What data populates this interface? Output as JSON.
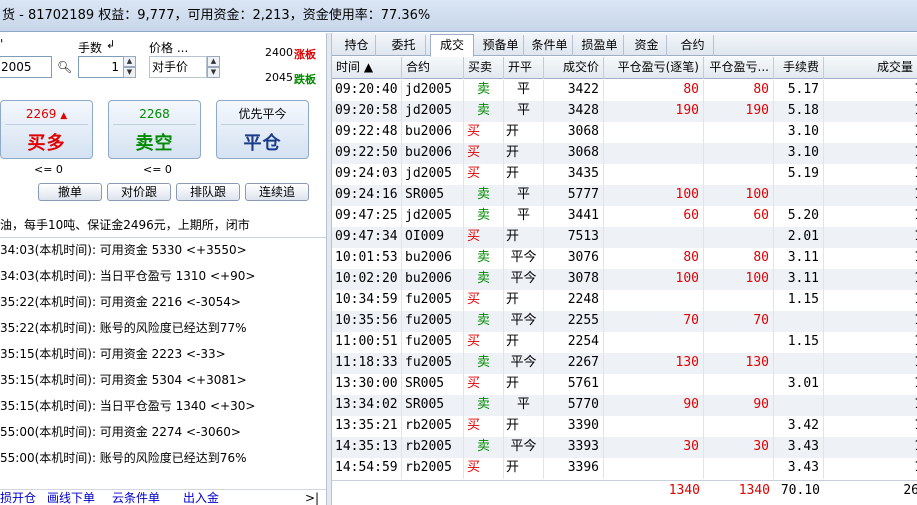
{
  "header": {
    "title": "货 - 81702189  权益：9,777，可用资金：2,213，资金使用率：77.36%"
  },
  "order": {
    "code_label": "'",
    "code_value": "2005",
    "qty_label": "手数",
    "qty_value": "1",
    "price_label": "价格 ...",
    "price_value": "对手价",
    "limit_up_price": "2400",
    "limit_up_label": "涨板",
    "limit_down_price": "2045",
    "limit_down_label": "跌板",
    "buy_price": "2269",
    "buy_label": "买多",
    "sell_price": "2268",
    "sell_label": "卖空",
    "close_top": "优先平今",
    "close_label": "平仓",
    "buy_avail": "<= 0",
    "sell_avail": "<= 0",
    "btn_cancel": "撤单",
    "btn_chase": "对价跟",
    "btn_queue": "排队跟",
    "btn_continuous": "连续追"
  },
  "info_line": "油，每手10吨、保证金2496元，上期所，闭市",
  "log": [
    "34:03(本机时间): 可用资金 5330 <+3550>",
    "34:03(本机时间): 当日平仓盈亏 1310 <+90>",
    "35:22(本机时间): 可用资金 2216 <-3054>",
    "35:22(本机时间): 账号的风险度已经达到77%",
    "35:15(本机时间): 可用资金 2223 <-33>",
    "35:15(本机时间): 可用资金 5304 <+3081>",
    "35:15(本机时间): 当日平仓盈亏 1340 <+30>",
    "55:00(本机时间): 可用资金 2274 <-3060>",
    "55:00(本机时间): 账号的风险度已经达到76%"
  ],
  "bottom_links": [
    "损开仓",
    "画线下单",
    "云条件单",
    "出入金",
    ">|"
  ],
  "tabs": [
    "持仓",
    "委托",
    "成交",
    "预备单",
    "条件单",
    "损盈单",
    "资金",
    "合约"
  ],
  "active_tab": 2,
  "columns": [
    "时间 ▲",
    "合约",
    "买卖",
    "开平",
    "成交价",
    "平仓盈亏(逐笔)",
    "平仓盈亏...",
    "手续费",
    "成交量"
  ],
  "rows": [
    [
      "09:20:40",
      "jd2005",
      "卖",
      "平",
      "3422",
      "80",
      "80",
      "5.17",
      "1"
    ],
    [
      "09:20:58",
      "jd2005",
      "卖",
      "平",
      "3428",
      "190",
      "190",
      "5.18",
      "1"
    ],
    [
      "09:22:48",
      "bu2006",
      "买",
      "开",
      "3068",
      "",
      "",
      "3.10",
      "1"
    ],
    [
      "09:22:50",
      "bu2006",
      "买",
      "开",
      "3068",
      "",
      "",
      "3.10",
      "1"
    ],
    [
      "09:24:03",
      "jd2005",
      "买",
      "开",
      "3435",
      "",
      "",
      "5.19",
      "1"
    ],
    [
      "09:24:16",
      "SR005",
      "卖",
      "平",
      "5777",
      "100",
      "100",
      "",
      "1"
    ],
    [
      "09:47:25",
      "jd2005",
      "卖",
      "平",
      "3441",
      "60",
      "60",
      "5.20",
      "1"
    ],
    [
      "09:47:34",
      "OI009",
      "买",
      "开",
      "7513",
      "",
      "",
      "2.01",
      "1"
    ],
    [
      "10:01:53",
      "bu2006",
      "卖",
      "平今",
      "3076",
      "80",
      "80",
      "3.11",
      "1"
    ],
    [
      "10:02:20",
      "bu2006",
      "卖",
      "平今",
      "3078",
      "100",
      "100",
      "3.11",
      "1"
    ],
    [
      "10:34:59",
      "fu2005",
      "买",
      "开",
      "2248",
      "",
      "",
      "1.15",
      "1"
    ],
    [
      "10:35:56",
      "fu2005",
      "卖",
      "平今",
      "2255",
      "70",
      "70",
      "",
      "1"
    ],
    [
      "11:00:51",
      "fu2005",
      "买",
      "开",
      "2254",
      "",
      "",
      "1.15",
      "1"
    ],
    [
      "11:18:33",
      "fu2005",
      "卖",
      "平今",
      "2267",
      "130",
      "130",
      "",
      "1"
    ],
    [
      "13:30:00",
      "SR005",
      "买",
      "开",
      "5761",
      "",
      "",
      "3.01",
      "1"
    ],
    [
      "13:34:02",
      "SR005",
      "卖",
      "平",
      "5770",
      "90",
      "90",
      "",
      "1"
    ],
    [
      "13:35:21",
      "rb2005",
      "买",
      "开",
      "3390",
      "",
      "",
      "3.42",
      "1"
    ],
    [
      "14:35:13",
      "rb2005",
      "卖",
      "平今",
      "3393",
      "30",
      "30",
      "3.43",
      "1"
    ],
    [
      "14:54:59",
      "rb2005",
      "买",
      "开",
      "3396",
      "",
      "",
      "3.43",
      "1"
    ]
  ],
  "totals": {
    "pnl_each": "1340",
    "pnl": "1340",
    "fee": "70.10",
    "qty": "26"
  },
  "colors": {
    "buy": "#e00000",
    "sell": "#008a00",
    "pnl": "#e00000"
  }
}
